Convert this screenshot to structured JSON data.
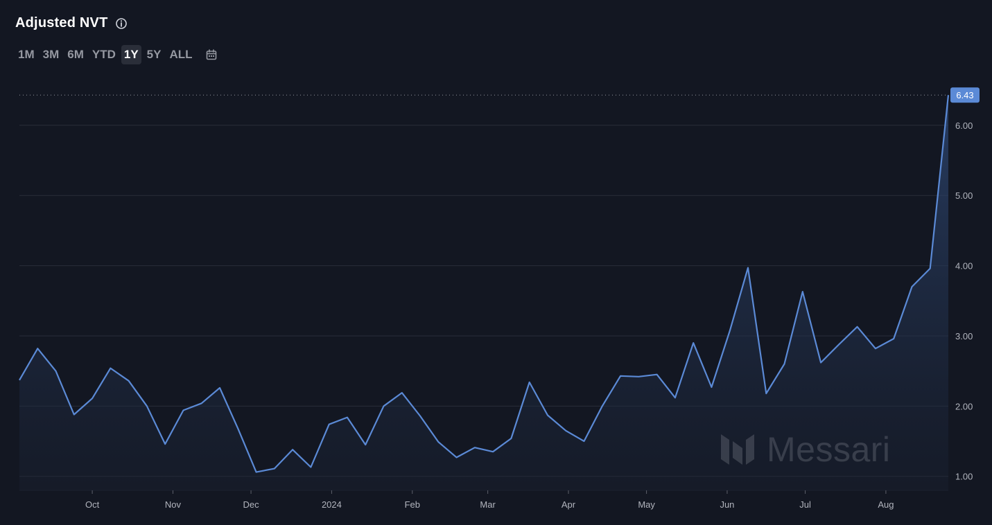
{
  "header": {
    "title": "Adjusted NVT"
  },
  "ranges": {
    "items": [
      "1M",
      "3M",
      "6M",
      "YTD",
      "1Y",
      "5Y",
      "ALL"
    ],
    "active": "1Y"
  },
  "watermark": {
    "text": "Messari"
  },
  "colors": {
    "background": "#131722",
    "line": "#5b8ad6",
    "grid": "#2a2e39",
    "badge": "#5b8ad6"
  },
  "chart_data": {
    "type": "area",
    "title": "Adjusted NVT",
    "xlabel": "",
    "ylabel": "",
    "ylim": [
      0.8,
      6.6
    ],
    "yticks": [
      1.0,
      2.0,
      3.0,
      4.0,
      5.0,
      6.0
    ],
    "ytick_labels": [
      "1.00",
      "2.00",
      "3.00",
      "4.00",
      "5.00",
      "6.00"
    ],
    "xtick_labels": [
      "Oct",
      "Nov",
      "Dec",
      "2024",
      "Feb",
      "Mar",
      "Apr",
      "May",
      "Jun",
      "Jul",
      "Aug"
    ],
    "xtick_dates": [
      "2023-10-01",
      "2023-11-01",
      "2023-12-01",
      "2024-01-01",
      "2024-02-01",
      "2024-03-01",
      "2024-04-01",
      "2024-05-01",
      "2024-06-01",
      "2024-07-01",
      "2024-08-01"
    ],
    "last_value_label": "6.43",
    "grid": true,
    "series": [
      {
        "x": [
          "2023-09-03",
          "2023-09-10",
          "2023-09-17",
          "2023-09-24",
          "2023-10-01",
          "2023-10-08",
          "2023-10-15",
          "2023-10-22",
          "2023-10-29",
          "2023-11-05",
          "2023-11-12",
          "2023-11-19",
          "2023-11-26",
          "2023-12-03",
          "2023-12-10",
          "2023-12-17",
          "2023-12-24",
          "2023-12-31",
          "2024-01-07",
          "2024-01-14",
          "2024-01-21",
          "2024-01-28",
          "2024-02-04",
          "2024-02-11",
          "2024-02-18",
          "2024-02-25",
          "2024-03-03",
          "2024-03-10",
          "2024-03-17",
          "2024-03-24",
          "2024-03-31",
          "2024-04-07",
          "2024-04-14",
          "2024-04-21",
          "2024-04-28",
          "2024-05-05",
          "2024-05-12",
          "2024-05-19",
          "2024-05-26",
          "2024-06-02",
          "2024-06-09",
          "2024-06-16",
          "2024-06-23",
          "2024-06-30",
          "2024-07-07",
          "2024-07-14",
          "2024-07-21",
          "2024-07-28",
          "2024-08-04",
          "2024-08-11",
          "2024-08-18",
          "2024-08-25"
        ],
        "values": [
          2.37,
          2.82,
          2.5,
          1.88,
          2.11,
          2.54,
          2.36,
          2.0,
          1.46,
          1.94,
          2.04,
          2.26,
          1.68,
          1.06,
          1.11,
          1.38,
          1.13,
          1.74,
          1.84,
          1.45,
          2.0,
          2.19,
          1.86,
          1.49,
          1.27,
          1.41,
          1.35,
          1.54,
          2.34,
          1.87,
          1.65,
          1.5,
          2.0,
          2.43,
          2.42,
          2.45,
          2.12,
          2.9,
          2.27,
          3.07,
          3.97,
          2.18,
          2.6,
          3.63,
          2.62,
          2.88,
          3.13,
          2.82,
          2.96,
          3.7,
          3.96,
          6.43
        ]
      }
    ]
  }
}
